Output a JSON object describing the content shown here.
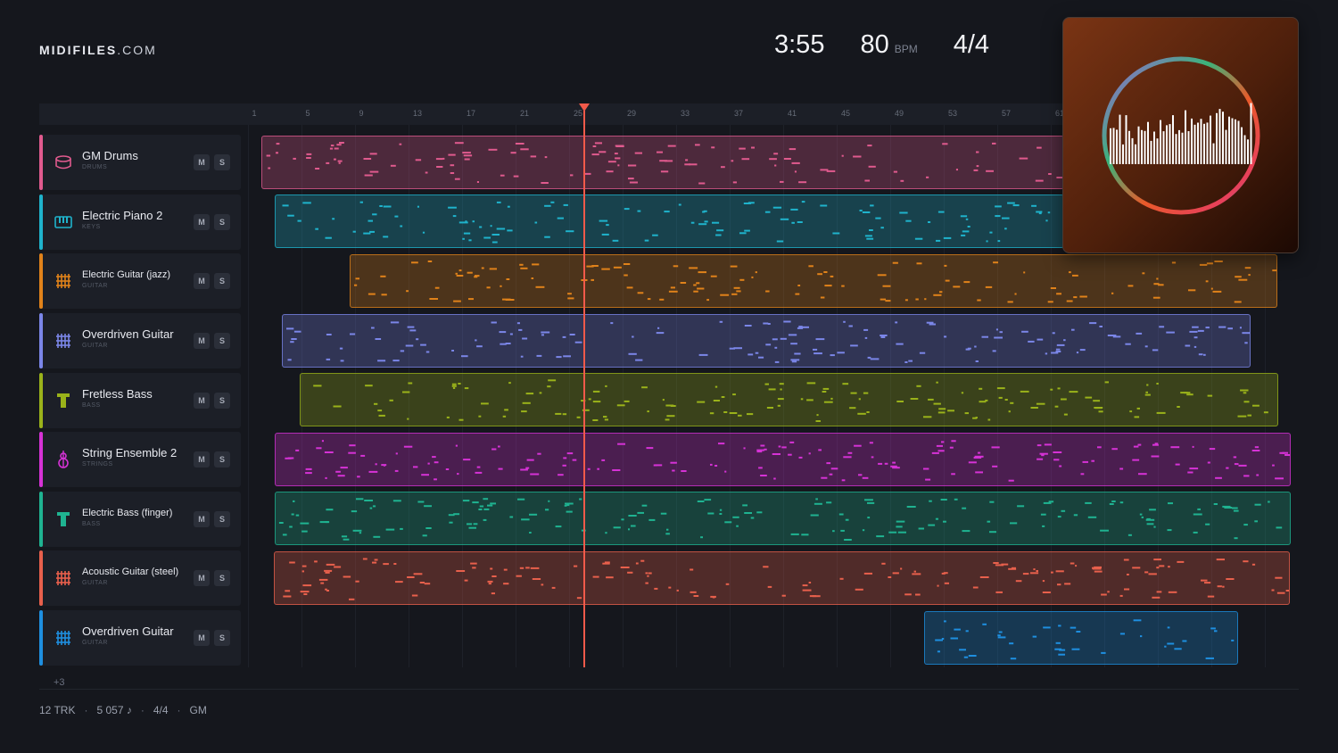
{
  "brand": {
    "name_bold": "MIDIFILES",
    "name_rest": ".COM"
  },
  "header": {
    "duration": "3:55",
    "tempo": "80",
    "tempo_unit": "BPM",
    "time_signature": "4/4"
  },
  "ruler": {
    "ticks": [
      "1",
      "5",
      "9",
      "13",
      "17",
      "21",
      "25",
      "29",
      "33",
      "37",
      "41",
      "45",
      "49",
      "53",
      "57",
      "61"
    ]
  },
  "tracks": [
    {
      "name": "GM Drums",
      "category": "DRUMS",
      "color": "#e05a8e",
      "icon": "drum-icon",
      "mute": "M",
      "solo": "S"
    },
    {
      "name": "Electric Piano 2",
      "category": "KEYS",
      "color": "#1fb3cc",
      "icon": "piano-icon",
      "mute": "M",
      "solo": "S"
    },
    {
      "name": "Electric Guitar (jazz)",
      "category": "GUITAR",
      "color": "#e0821a",
      "icon": "guitar-icon",
      "mute": "M",
      "solo": "S"
    },
    {
      "name": "Overdriven Guitar",
      "category": "GUITAR",
      "color": "#7b86e8",
      "icon": "guitar-icon",
      "mute": "M",
      "solo": "S"
    },
    {
      "name": "Fretless Bass",
      "category": "BASS",
      "color": "#9ab21a",
      "icon": "bass-icon",
      "mute": "M",
      "solo": "S"
    },
    {
      "name": "String Ensemble 2",
      "category": "STRINGS",
      "color": "#d632d6",
      "icon": "strings-icon",
      "mute": "M",
      "solo": "S"
    },
    {
      "name": "Electric Bass (finger)",
      "category": "BASS",
      "color": "#1fb391",
      "icon": "bass-icon",
      "mute": "M",
      "solo": "S"
    },
    {
      "name": "Acoustic Guitar (steel)",
      "category": "GUITAR",
      "color": "#e8604c",
      "icon": "guitar-icon",
      "mute": "M",
      "solo": "S"
    },
    {
      "name": "Overdriven Guitar",
      "category": "GUITAR",
      "color": "#1e8fe0",
      "icon": "guitar-icon",
      "mute": "M",
      "solo": "S"
    }
  ],
  "more_tracks": "+3",
  "footer": {
    "tracks": "12 TRK",
    "notes": "5 057 ♪",
    "meter": "4/4",
    "standard": "GM"
  }
}
